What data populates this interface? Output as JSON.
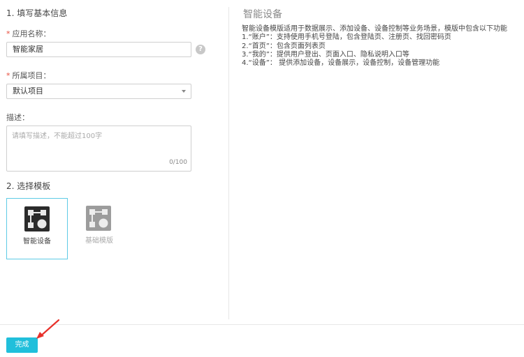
{
  "form": {
    "section1_title": "1. 填写基本信息",
    "app_name": {
      "label": "应用名称：",
      "value": "智能家居",
      "help": "?"
    },
    "project": {
      "label": "所属项目：",
      "value": "默认项目"
    },
    "description": {
      "label": "描述：",
      "placeholder": "请填写描述，不能超过100字",
      "counter": "0/100"
    },
    "section2_title": "2. 选择模板",
    "templates": [
      {
        "label": "智能设备",
        "selected": true,
        "icon": "smart-device-icon"
      },
      {
        "label": "基础模版",
        "selected": false,
        "icon": "basic-template-icon"
      }
    ]
  },
  "info": {
    "title": "智能设备",
    "lines": [
      "智能设备模版适用于数据展示、添加设备、设备控制等业务场景，模版中包含以下功能",
      "1.“账户”：支持使用手机号登陆，包含登陆页、注册页、找回密码页",
      "2.“首页”：包含页面列表页",
      "3.“我的”：提供用户登出、页面入口、隐私说明入口等",
      "4.“设备”： 提供添加设备，设备展示，设备控制，设备管理功能"
    ]
  },
  "footer": {
    "done_label": "完成"
  },
  "colors": {
    "accent": "#20bfdb",
    "selected_border": "#5ecbe6",
    "required": "#e74c3c",
    "annotation_arrow": "#e8302a"
  }
}
